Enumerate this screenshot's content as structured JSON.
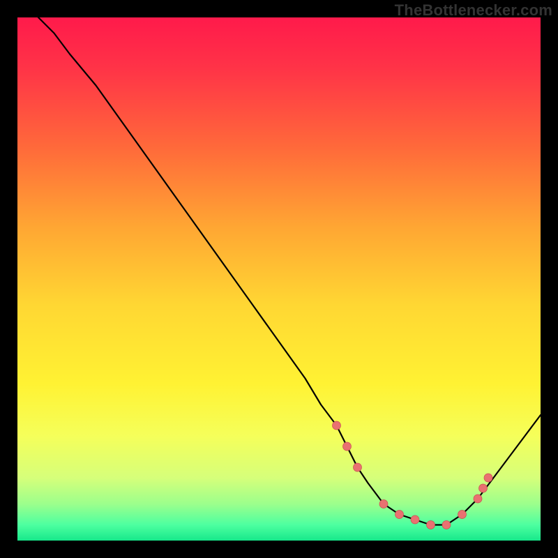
{
  "header": {
    "watermark": "TheBottlenecker.com"
  },
  "chart_data": {
    "type": "line",
    "title": "",
    "xlabel": "",
    "ylabel": "",
    "xlim": [
      0,
      100
    ],
    "ylim": [
      0,
      100
    ],
    "grid": false,
    "series": [
      {
        "name": "curve",
        "x": [
          4,
          7,
          10,
          15,
          20,
          25,
          30,
          35,
          40,
          45,
          50,
          55,
          58,
          61,
          63,
          65,
          67,
          70,
          73,
          76,
          79,
          82,
          85,
          88,
          91,
          94,
          97,
          100
        ],
        "y": [
          100,
          97,
          93,
          87,
          80,
          73,
          66,
          59,
          52,
          45,
          38,
          31,
          26,
          22,
          18,
          14,
          11,
          7,
          5,
          4,
          3,
          3,
          5,
          8,
          12,
          16,
          20,
          24
        ]
      }
    ],
    "highlight_points": {
      "name": "markers",
      "x": [
        61,
        63,
        65,
        70,
        73,
        76,
        79,
        82,
        85,
        88,
        89,
        90
      ],
      "y": [
        22,
        18,
        14,
        7,
        5,
        4,
        3,
        3,
        5,
        8,
        10,
        12
      ]
    },
    "background_gradient": {
      "stops": [
        {
          "offset": 0.0,
          "color": "#ff1a4b"
        },
        {
          "offset": 0.1,
          "color": "#ff3447"
        },
        {
          "offset": 0.25,
          "color": "#ff6a3a"
        },
        {
          "offset": 0.4,
          "color": "#ffa633"
        },
        {
          "offset": 0.55,
          "color": "#ffd733"
        },
        {
          "offset": 0.7,
          "color": "#fff233"
        },
        {
          "offset": 0.8,
          "color": "#f5ff5a"
        },
        {
          "offset": 0.88,
          "color": "#d6ff7a"
        },
        {
          "offset": 0.93,
          "color": "#9cff8c"
        },
        {
          "offset": 0.97,
          "color": "#4dffa0"
        },
        {
          "offset": 1.0,
          "color": "#17e88b"
        }
      ]
    }
  }
}
